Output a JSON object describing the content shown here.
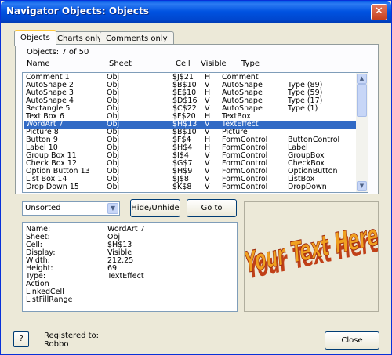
{
  "window": {
    "title": "Navigator Objects: Objects",
    "close_glyph": "✕"
  },
  "tabs": [
    {
      "label": "Objects",
      "active": true
    },
    {
      "label": "Charts only",
      "active": false
    },
    {
      "label": "Comments only",
      "active": false
    }
  ],
  "objects_count": "Objects:  7 of 50",
  "columns": {
    "name": "Name",
    "sheet": "Sheet",
    "cell": "Cell",
    "visible": "Visible",
    "type": "Type"
  },
  "rows": [
    {
      "name": "Comment 1",
      "sheet": "Obj",
      "cell": "$J$21",
      "visible": "H",
      "type": "Comment",
      "detail": ""
    },
    {
      "name": "AutoShape 2",
      "sheet": "Obj",
      "cell": "$B$10",
      "visible": "V",
      "type": "AutoShape",
      "detail": "Type (89)"
    },
    {
      "name": "AutoShape 3",
      "sheet": "Obj",
      "cell": "$E$10",
      "visible": "H",
      "type": "AutoShape",
      "detail": "Type (59)"
    },
    {
      "name": "AutoShape 4",
      "sheet": "Obj",
      "cell": "$D$16",
      "visible": "V",
      "type": "AutoShape",
      "detail": "Type (17)"
    },
    {
      "name": "Rectangle 5",
      "sheet": "Obj",
      "cell": "$C$22",
      "visible": "V",
      "type": "AutoShape",
      "detail": "Type (1)"
    },
    {
      "name": "Text Box 6",
      "sheet": "Obj",
      "cell": "$F$20",
      "visible": "H",
      "type": "TextBox",
      "detail": ""
    },
    {
      "name": "WordArt 7",
      "sheet": "Obj",
      "cell": "$H$13",
      "visible": "V",
      "type": "TextEffect",
      "detail": "",
      "selected": true
    },
    {
      "name": "Picture 8",
      "sheet": "Obj",
      "cell": "$B$10",
      "visible": "V",
      "type": "Picture",
      "detail": ""
    },
    {
      "name": "Button 9",
      "sheet": "Obj",
      "cell": "$F$4",
      "visible": "H",
      "type": "FormControl",
      "detail": "ButtonControl"
    },
    {
      "name": "Label 10",
      "sheet": "Obj",
      "cell": "$H$4",
      "visible": "H",
      "type": "FormControl",
      "detail": "Label"
    },
    {
      "name": "Group Box 11",
      "sheet": "Obj",
      "cell": "$I$4",
      "visible": "V",
      "type": "FormControl",
      "detail": "GroupBox"
    },
    {
      "name": "Check Box 12",
      "sheet": "Obj",
      "cell": "$G$7",
      "visible": "V",
      "type": "FormControl",
      "detail": "CheckBox"
    },
    {
      "name": "Option Button 13",
      "sheet": "Obj",
      "cell": "$H$9",
      "visible": "V",
      "type": "FormControl",
      "detail": "OptionButton"
    },
    {
      "name": "List Box 14",
      "sheet": "Obj",
      "cell": "$J$8",
      "visible": "V",
      "type": "FormControl",
      "detail": "ListBox"
    },
    {
      "name": "Drop Down 15",
      "sheet": "Obj",
      "cell": "$K$8",
      "visible": "V",
      "type": "FormControl",
      "detail": "DropDown"
    }
  ],
  "sort": {
    "selected": "Unsorted"
  },
  "buttons": {
    "hide_unhide": "Hide/Unhide",
    "go_to": "Go to",
    "close": "Close",
    "help": "?"
  },
  "properties": [
    {
      "label": "Name:",
      "value": "WordArt 7"
    },
    {
      "label": "Sheet:",
      "value": "Obj"
    },
    {
      "label": "Cell:",
      "value": "$H$13"
    },
    {
      "label": "Display:",
      "value": "Visible"
    },
    {
      "label": "Width:",
      "value": "212.25"
    },
    {
      "label": "Height:",
      "value": "69"
    },
    {
      "label": "Type:",
      "value": "TextEffect"
    },
    {
      "label": "Action",
      "value": ""
    },
    {
      "label": "LinkedCell",
      "value": ""
    },
    {
      "label": "ListFillRange",
      "value": ""
    }
  ],
  "preview": {
    "wordart_text": "Your Text Here",
    "fill_color": "#f0a020",
    "shadow_color": "#c04018"
  },
  "registration": {
    "label": "Registered to:",
    "user": "Robbo"
  }
}
